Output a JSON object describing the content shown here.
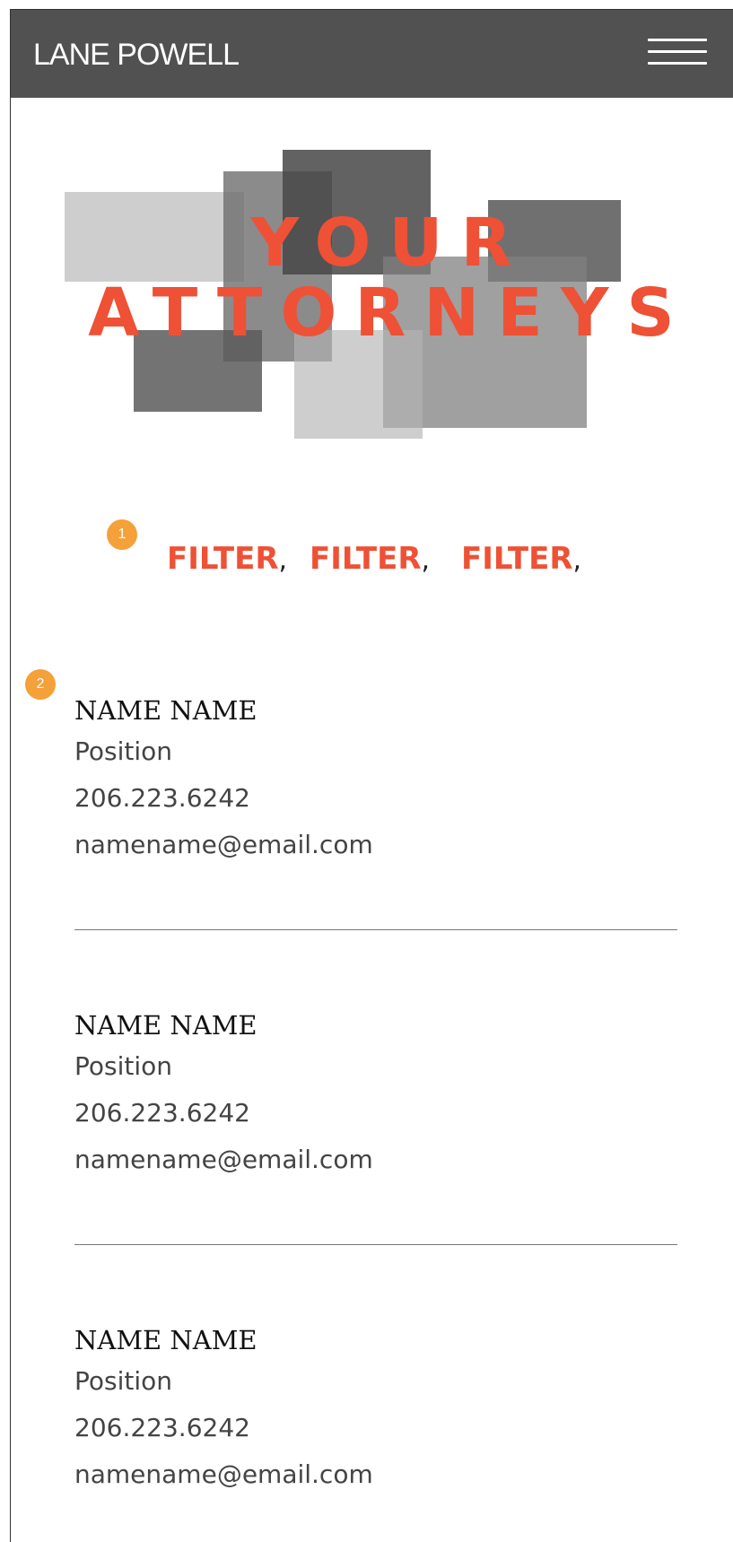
{
  "header": {
    "logo": "LANE POWELL",
    "menu_icon": "hamburger-menu-icon",
    "background": "#515151"
  },
  "hero": {
    "title_line1": "YOUR",
    "title_line2": "ATTORNEYS",
    "accent": "#ee5135"
  },
  "badges": {
    "one": "1",
    "two": "2",
    "color": "#f4a13a"
  },
  "filters": [
    {
      "label": "FILTER",
      "separator": ","
    },
    {
      "label": "FILTER",
      "separator": ","
    },
    {
      "label": "FILTER",
      "separator": ","
    }
  ],
  "attorneys": [
    {
      "name": "NAME NAME",
      "position": "Position",
      "phone": "206.223.6242",
      "email": "namename@email.com"
    },
    {
      "name": "NAME NAME",
      "position": "Position",
      "phone": "206.223.6242",
      "email": "namename@email.com"
    },
    {
      "name": "NAME NAME",
      "position": "Position",
      "phone": "206.223.6242",
      "email": "namename@email.com"
    }
  ]
}
